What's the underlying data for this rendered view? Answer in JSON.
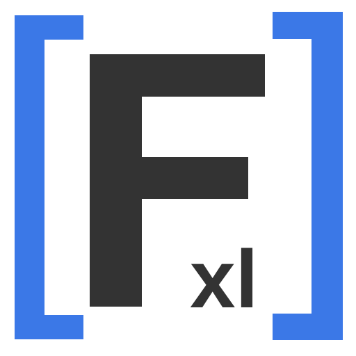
{
  "logo": {
    "letter": "F",
    "subscript": "xl",
    "colors": {
      "bracket": "#3b78e7",
      "letter": "#333333",
      "background": "#ffffff"
    },
    "icons": [
      "left-bracket-icon",
      "right-bracket-icon"
    ]
  }
}
